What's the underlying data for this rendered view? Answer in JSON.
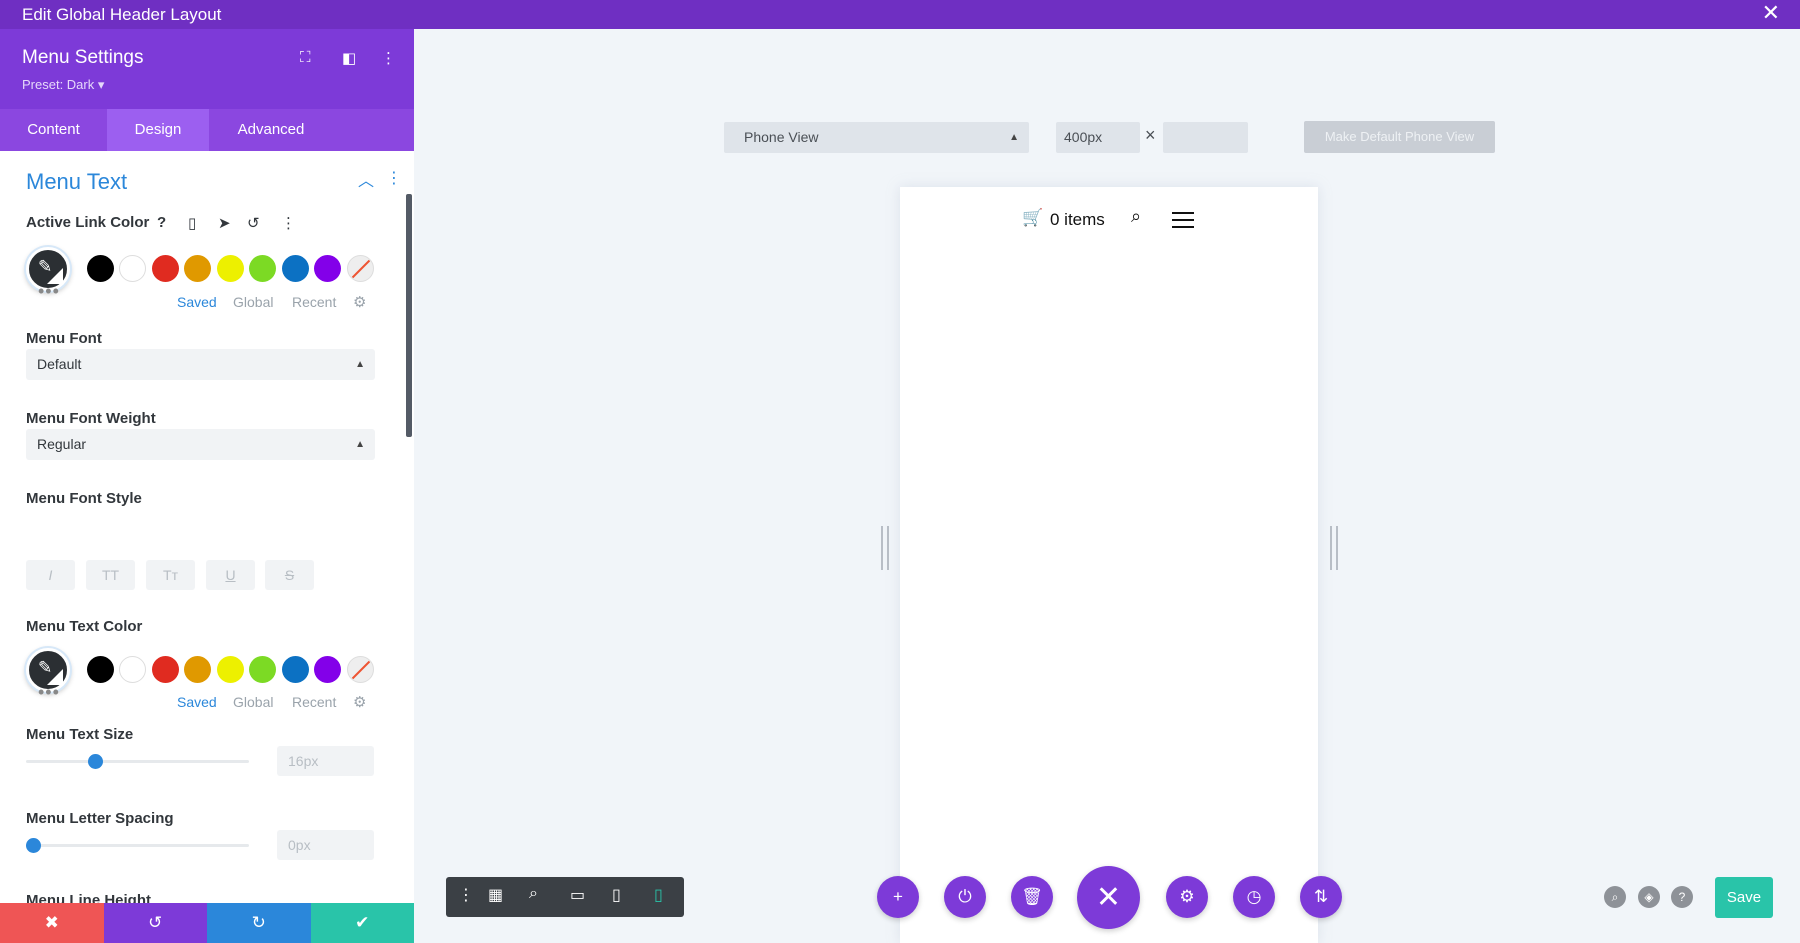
{
  "window": {
    "title": "Edit Global Header Layout",
    "close_icon": "close-icon"
  },
  "panel": {
    "title": "Menu Settings",
    "preset": "Preset: Dark ▾",
    "tabs": [
      "Content",
      "Design",
      "Advanced"
    ],
    "active_tab": "Design",
    "section_title": "Menu Text",
    "active_link_color": {
      "label": "Active Link Color",
      "palette_tabs": [
        "Saved",
        "Global",
        "Recent"
      ],
      "selected_palette": "Saved"
    },
    "swatches": [
      "#000000",
      "#ffffff",
      "#e02b20",
      "#e09900",
      "#edf000",
      "#7cda24",
      "#0c71c3",
      "#8300e9"
    ],
    "menu_font": {
      "label": "Menu Font",
      "value": "Default"
    },
    "menu_font_weight": {
      "label": "Menu Font Weight",
      "value": "Regular"
    },
    "menu_font_style": {
      "label": "Menu Font Style",
      "buttons": [
        "I",
        "TT",
        "Tт",
        "U",
        "S"
      ]
    },
    "menu_text_color": {
      "label": "Menu Text Color",
      "palette_tabs": [
        "Saved",
        "Global",
        "Recent"
      ]
    },
    "menu_text_size": {
      "label": "Menu Text Size",
      "value": "16px",
      "slider_fraction": 0.3
    },
    "menu_letter_spacing": {
      "label": "Menu Letter Spacing",
      "value": "0px",
      "slider_fraction": 0.0
    },
    "menu_line_height": {
      "label": "Menu Line Height"
    },
    "footer_buttons": [
      "✖",
      "↺",
      "↻",
      "✔"
    ],
    "footer_colors": [
      "#ef5555",
      "#7d3ad8",
      "#2b87da",
      "#29c4a9"
    ]
  },
  "canvas": {
    "view_select": "Phone View",
    "width_value": "400px",
    "height_value": "",
    "make_default_label": "Make Default Phone View",
    "cart_text": "0 items",
    "save_label": "Save"
  },
  "colors": {
    "accent": "#7d3ad8",
    "blue": "#2b87da",
    "green": "#29c4a9"
  }
}
